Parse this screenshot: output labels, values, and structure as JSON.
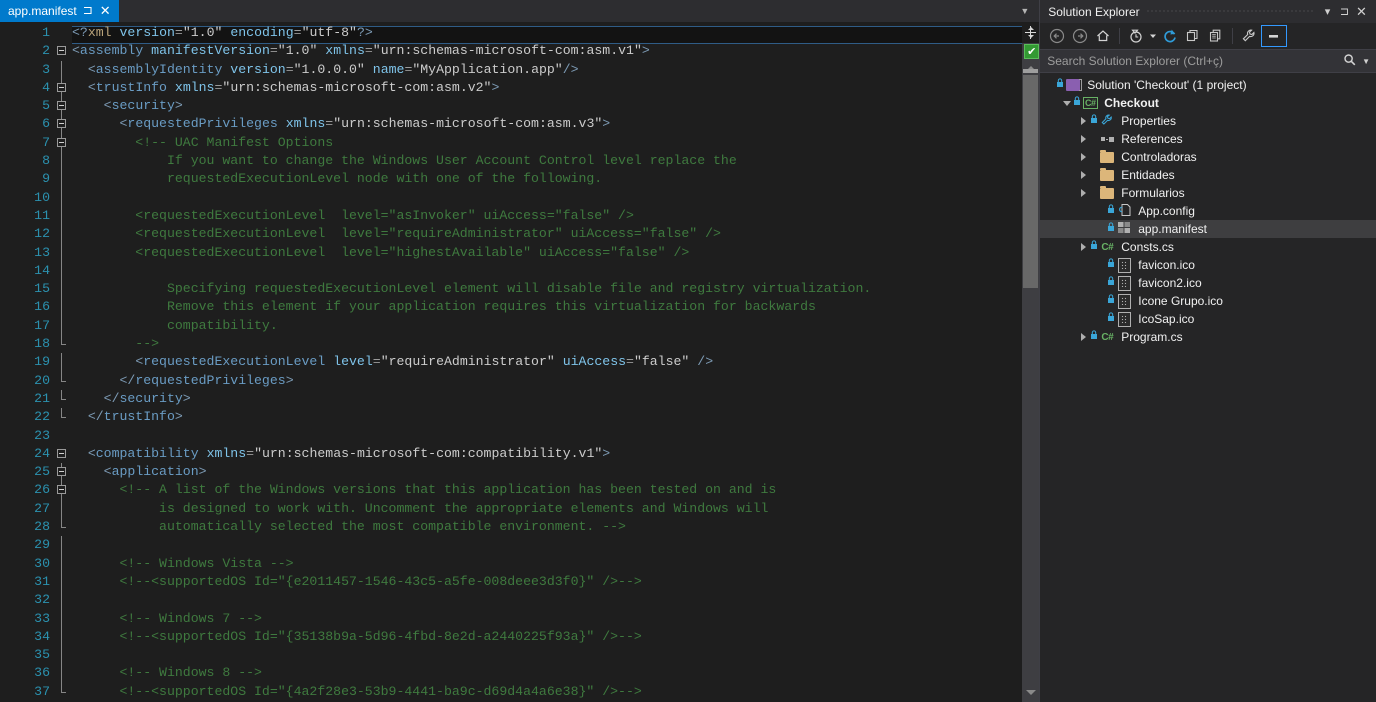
{
  "tab": {
    "label": "app.manifest",
    "pin_icon": "pin-icon",
    "close_icon": "close-icon",
    "overflow_icon": "chevron-down-icon"
  },
  "editor": {
    "language": "xml",
    "first_visible_line": 1,
    "last_visible_line": 37,
    "active_line": 1,
    "line_numbers": [
      1,
      2,
      3,
      4,
      5,
      6,
      7,
      8,
      9,
      10,
      11,
      12,
      13,
      14,
      15,
      16,
      17,
      18,
      19,
      20,
      21,
      22,
      23,
      24,
      25,
      26,
      27,
      28,
      29,
      30,
      31,
      32,
      33,
      34,
      35,
      36,
      37
    ],
    "lines": [
      "<?xml version=\"1.0\" encoding=\"utf-8\"?>",
      "<assembly manifestVersion=\"1.0\" xmlns=\"urn:schemas-microsoft-com:asm.v1\">",
      "  <assemblyIdentity version=\"1.0.0.0\" name=\"MyApplication.app\"/>",
      "  <trustInfo xmlns=\"urn:schemas-microsoft-com:asm.v2\">",
      "    <security>",
      "      <requestedPrivileges xmlns=\"urn:schemas-microsoft-com:asm.v3\">",
      "        <!-- UAC Manifest Options",
      "            If you want to change the Windows User Account Control level replace the",
      "            requestedExecutionLevel node with one of the following.",
      "",
      "        <requestedExecutionLevel  level=\"asInvoker\" uiAccess=\"false\" />",
      "        <requestedExecutionLevel  level=\"requireAdministrator\" uiAccess=\"false\" />",
      "        <requestedExecutionLevel  level=\"highestAvailable\" uiAccess=\"false\" />",
      "",
      "            Specifying requestedExecutionLevel element will disable file and registry virtualization.",
      "            Remove this element if your application requires this virtualization for backwards",
      "            compatibility.",
      "        -->",
      "        <requestedExecutionLevel level=\"requireAdministrator\" uiAccess=\"false\" />",
      "      </requestedPrivileges>",
      "    </security>",
      "  </trustInfo>",
      "",
      "  <compatibility xmlns=\"urn:schemas-microsoft-com:compatibility.v1\">",
      "    <application>",
      "      <!-- A list of the Windows versions that this application has been tested on and is",
      "           is designed to work with. Uncomment the appropriate elements and Windows will",
      "           automatically selected the most compatible environment. -->",
      "",
      "      <!-- Windows Vista -->",
      "      <!--<supportedOS Id=\"{e2011457-1546-43c5-a5fe-008deee3d3f0}\" />-->",
      "",
      "      <!-- Windows 7 -->",
      "      <!--<supportedOS Id=\"{35138b9a-5d96-4fbd-8e2d-a2440225f93a}\" />-->",
      "",
      "      <!-- Windows 8 -->",
      "      <!--<supportedOS Id=\"{4a2f28e3-53b9-4441-ba9c-d69d4a4a6e38}\" />-->"
    ],
    "selection_text": "<?xml version=\"1.0\" encoding=\"utf-8\"?>",
    "fold_lines": [
      2,
      4,
      5,
      6,
      7,
      24,
      25,
      26
    ],
    "scrollbar": {
      "split_icon": "split-view-icon",
      "health_icon": "code-health-ok-icon",
      "scroll_up_icon": "arrow-up-icon",
      "scroll_down_icon": "arrow-down-icon"
    },
    "colors": {
      "background": "#1e1e1e",
      "line_number": "#2b91af",
      "tag": "#6a9cc4",
      "attribute": "#7fc4ea",
      "value": "#cccccc",
      "comment": "#3f7a3f",
      "selection": "#264f78",
      "accent": "#007acc"
    }
  },
  "solution_explorer": {
    "title": "Solution Explorer",
    "title_buttons": [
      {
        "name": "dropdown-icon",
        "glyph": "▾"
      },
      {
        "name": "pin-icon",
        "glyph": "⊐"
      },
      {
        "name": "close-icon",
        "glyph": "✕"
      }
    ],
    "toolbar": [
      {
        "name": "back-button",
        "tooltip": "Back"
      },
      {
        "name": "forward-button",
        "tooltip": "Forward"
      },
      {
        "name": "home-button",
        "tooltip": "Home"
      },
      {
        "name": "pending-changes-button",
        "tooltip": "Pending Changes Filter"
      },
      {
        "name": "refresh-button",
        "tooltip": "Refresh"
      },
      {
        "name": "collapse-all-button",
        "tooltip": "Collapse All"
      },
      {
        "name": "show-all-files-button",
        "tooltip": "Show All Files"
      },
      {
        "name": "properties-button",
        "tooltip": "Properties"
      },
      {
        "name": "preview-selected-items-button",
        "tooltip": "Preview Selected Items"
      }
    ],
    "search": {
      "placeholder": "Search Solution Explorer (Ctrl+ç)",
      "value": "",
      "icon": "search-icon",
      "dropdown_icon": "chevron-down-icon"
    },
    "tree": [
      {
        "label": "Solution 'Checkout' (1 project)",
        "indent": 0,
        "expander": "none",
        "icon": "solution-icon",
        "locked": true,
        "bold": false,
        "selected": false
      },
      {
        "label": "Checkout",
        "indent": 1,
        "expander": "down",
        "icon": "csharp-project-icon",
        "locked": true,
        "bold": true,
        "selected": false
      },
      {
        "label": "Properties",
        "indent": 2,
        "expander": "right",
        "icon": "wrench-icon",
        "locked": true,
        "bold": false,
        "selected": false
      },
      {
        "label": "References",
        "indent": 2,
        "expander": "right",
        "icon": "references-icon",
        "locked": false,
        "bold": false,
        "selected": false
      },
      {
        "label": "Controladoras",
        "indent": 2,
        "expander": "right",
        "icon": "folder-icon",
        "locked": false,
        "bold": false,
        "selected": false
      },
      {
        "label": "Entidades",
        "indent": 2,
        "expander": "right",
        "icon": "folder-icon",
        "locked": false,
        "bold": false,
        "selected": false
      },
      {
        "label": "Formularios",
        "indent": 2,
        "expander": "right",
        "icon": "folder-icon",
        "locked": false,
        "bold": false,
        "selected": false
      },
      {
        "label": "App.config",
        "indent": 3,
        "expander": "none",
        "icon": "config-file-icon",
        "locked": true,
        "bold": false,
        "selected": false
      },
      {
        "label": "app.manifest",
        "indent": 3,
        "expander": "none",
        "icon": "manifest-file-icon",
        "locked": true,
        "bold": false,
        "selected": true
      },
      {
        "label": "Consts.cs",
        "indent": 2,
        "expander": "right",
        "icon": "csharp-file-icon",
        "locked": true,
        "bold": false,
        "selected": false
      },
      {
        "label": "favicon.ico",
        "indent": 3,
        "expander": "none",
        "icon": "image-file-icon",
        "locked": true,
        "bold": false,
        "selected": false
      },
      {
        "label": "favicon2.ico",
        "indent": 3,
        "expander": "none",
        "icon": "image-file-icon",
        "locked": true,
        "bold": false,
        "selected": false
      },
      {
        "label": "Icone Grupo.ico",
        "indent": 3,
        "expander": "none",
        "icon": "image-file-icon",
        "locked": true,
        "bold": false,
        "selected": false
      },
      {
        "label": "IcoSap.ico",
        "indent": 3,
        "expander": "none",
        "icon": "image-file-icon",
        "locked": true,
        "bold": false,
        "selected": false
      },
      {
        "label": "Program.cs",
        "indent": 2,
        "expander": "right",
        "icon": "csharp-file-icon",
        "locked": true,
        "bold": false,
        "selected": false
      }
    ]
  }
}
